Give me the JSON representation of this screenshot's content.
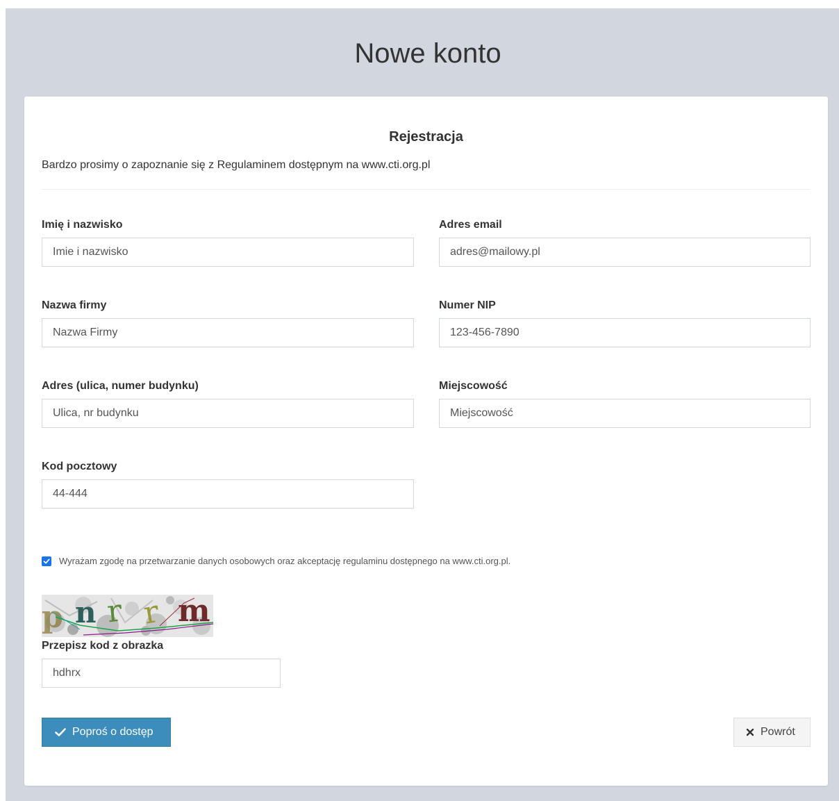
{
  "page": {
    "title": "Nowe konto"
  },
  "card": {
    "title": "Rejestracja",
    "subtitle": "Bardzo prosimy o zapoznanie się z Regulaminem dostępnym na www.cti.org.pl"
  },
  "form": {
    "name": {
      "label": "Imię i nazwisko",
      "placeholder": "Imie i nazwisko",
      "value": ""
    },
    "email": {
      "label": "Adres email",
      "placeholder": "adres@mailowy.pl",
      "value": ""
    },
    "company": {
      "label": "Nazwa firmy",
      "placeholder": "Nazwa Firmy",
      "value": ""
    },
    "nip": {
      "label": "Numer NIP",
      "placeholder": "123-456-7890",
      "value": ""
    },
    "address": {
      "label": "Adres (ulica, numer budynku)",
      "placeholder": "Ulica, nr budynku",
      "value": ""
    },
    "city": {
      "label": "Miejscowość",
      "placeholder": "Miejscowość",
      "value": ""
    },
    "postal": {
      "label": "Kod pocztowy",
      "placeholder": "44-444",
      "value": ""
    },
    "consent": {
      "checked": true,
      "text": "Wyrażam zgodę na przetwarzanie danych osobowych oraz akceptację regulaminu dostępnego na www.cti.org.pl."
    },
    "captcha": {
      "image_text": "pnrrm",
      "label": "Przepisz kod z obrazka",
      "placeholder": "",
      "value": "hdhrx"
    }
  },
  "buttons": {
    "submit_label": "Poproś o dostęp",
    "back_label": "Powrót"
  },
  "colors": {
    "background": "#d2d6de",
    "primary": "#3c8dbc",
    "checkbox": "#1a73e8"
  },
  "icons": {
    "submit": "check-icon",
    "back": "close-icon"
  }
}
